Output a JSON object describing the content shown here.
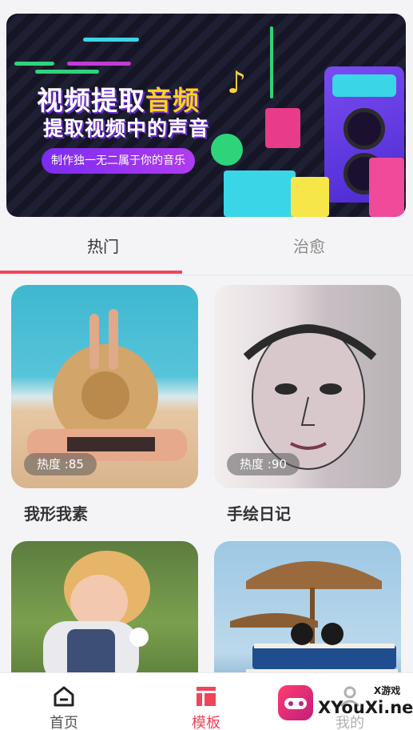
{
  "banner": {
    "title_main": "视频提取",
    "title_highlight": "音频",
    "subtitle": "提取视频中的声音",
    "pill_text": "制作独一无二属于你的音乐"
  },
  "tabs": [
    {
      "label": "热门",
      "active": true
    },
    {
      "label": "治愈",
      "active": false
    }
  ],
  "cards": [
    {
      "title": "我形我素",
      "heat": "热度 :85",
      "image": "beach-sunhat"
    },
    {
      "title": "手绘日记",
      "heat": "热度 :90",
      "image": "sketch-portrait"
    },
    {
      "title": "",
      "heat": "",
      "image": "child-flower"
    },
    {
      "title": "",
      "heat": "",
      "image": "beach-umbrella-books"
    }
  ],
  "bottom_nav": [
    {
      "label": "首页",
      "icon": "home-icon",
      "active": false
    },
    {
      "label": "模板",
      "icon": "template-icon",
      "active": true
    },
    {
      "label": "我的",
      "icon": "profile-icon",
      "active": false
    }
  ],
  "watermark": {
    "text": "XYouXi.net",
    "small": "X游戏"
  },
  "colors": {
    "accent": "#f0445a",
    "highlight": "#ffd21f",
    "banner_purple": "#7b2cf0"
  }
}
